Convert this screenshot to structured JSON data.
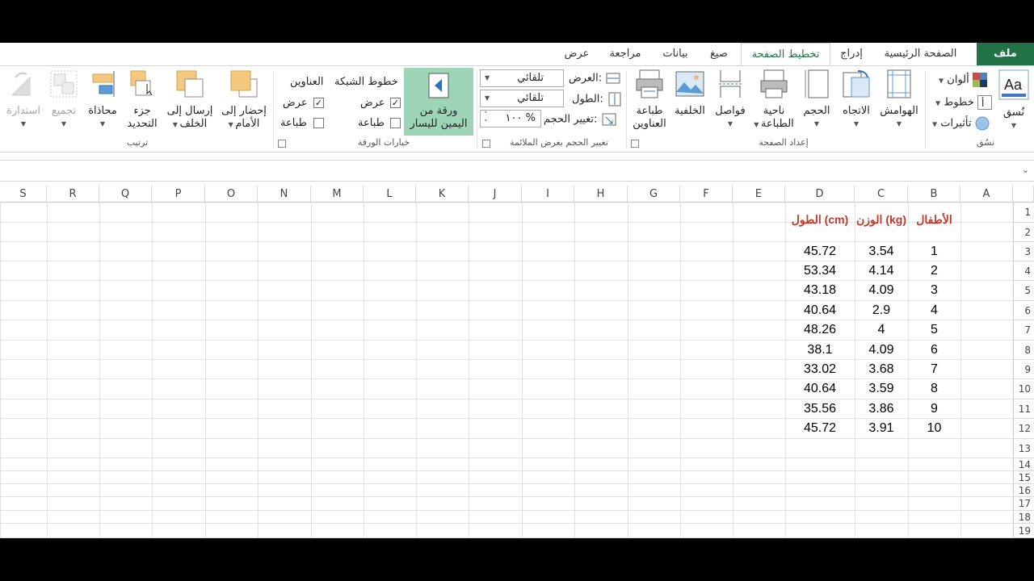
{
  "tabs": [
    {
      "id": "file",
      "label": "ملف"
    },
    {
      "id": "home",
      "label": "الصفحة الرئيسية"
    },
    {
      "id": "insert",
      "label": "إدراج"
    },
    {
      "id": "pagelayout",
      "label": "تخطيط الصفحة"
    },
    {
      "id": "formulas",
      "label": "صيغ"
    },
    {
      "id": "data",
      "label": "بيانات"
    },
    {
      "id": "review",
      "label": "مراجعة"
    },
    {
      "id": "view",
      "label": "عرض"
    }
  ],
  "ribbon": {
    "themes": {
      "label": "نسُق",
      "themes_btn": "نُسق",
      "colors": "ألوان",
      "fonts": "خطوط",
      "effects": "تأثيرات"
    },
    "page_setup": {
      "label": "إعداد الصفحة",
      "margins": "الهوامش",
      "orientation": "الاتجاه",
      "size": "الحجم",
      "print_area_1": "ناحية",
      "print_area_2": "الطباعة",
      "breaks": "فواصل",
      "background": "الخلفية",
      "print_titles_1": "طباعة",
      "print_titles_2": "العناوين"
    },
    "scale": {
      "label": "تغيير الحجم بغرض الملائمة",
      "width_label": "العرض:",
      "width_value": "تلقائي",
      "height_label": "الطول:",
      "height_value": "تلقائي",
      "scale_label": "تغيير الحجم:",
      "scale_value": "١٠٠ %"
    },
    "sheet_options": {
      "label": "خيارات الورقة",
      "rtl_1": "ورقة من",
      "rtl_2": "اليمين لليسار",
      "gridlines": "خطوط الشبكة",
      "headings": "العناوين",
      "view": "عرض",
      "print": "طباعة"
    },
    "arrange": {
      "label": "ترتيب",
      "bring_forward_1": "إحضار إلى",
      "bring_forward_2": "الأمام",
      "send_backward_1": "إرسال إلى",
      "send_backward_2": "الخلف",
      "selection_1": "جزء",
      "selection_2": "التحديد",
      "align": "محاذاة",
      "group": "تجميع",
      "rotate": "استدارة"
    }
  },
  "columns": [
    "S",
    "R",
    "Q",
    "P",
    "O",
    "N",
    "M",
    "L",
    "K",
    "J",
    "I",
    "H",
    "G",
    "F",
    "E",
    "D",
    "C",
    "B",
    "A"
  ],
  "rows": [
    "1",
    "2",
    "3",
    "4",
    "5",
    "6",
    "7",
    "8",
    "9",
    "10",
    "11",
    "12",
    "13",
    "14",
    "15",
    "16",
    "17",
    "18",
    "19"
  ],
  "table": {
    "headers": {
      "b": "الأطفال",
      "c": "الوزن (kg)",
      "d": "الطول (cm)"
    },
    "rows": [
      {
        "b": "1",
        "c": "3.54",
        "d": "45.72"
      },
      {
        "b": "2",
        "c": "4.14",
        "d": "53.34"
      },
      {
        "b": "3",
        "c": "4.09",
        "d": "43.18"
      },
      {
        "b": "4",
        "c": "2.9",
        "d": "40.64"
      },
      {
        "b": "5",
        "c": "4",
        "d": "48.26"
      },
      {
        "b": "6",
        "c": "4.09",
        "d": "38.1"
      },
      {
        "b": "7",
        "c": "3.68",
        "d": "33.02"
      },
      {
        "b": "8",
        "c": "3.59",
        "d": "40.64"
      },
      {
        "b": "9",
        "c": "3.86",
        "d": "35.56"
      },
      {
        "b": "10",
        "c": "3.91",
        "d": "45.72"
      }
    ]
  },
  "colors": {
    "accent": "#217346",
    "header_text": "#c0392b"
  }
}
